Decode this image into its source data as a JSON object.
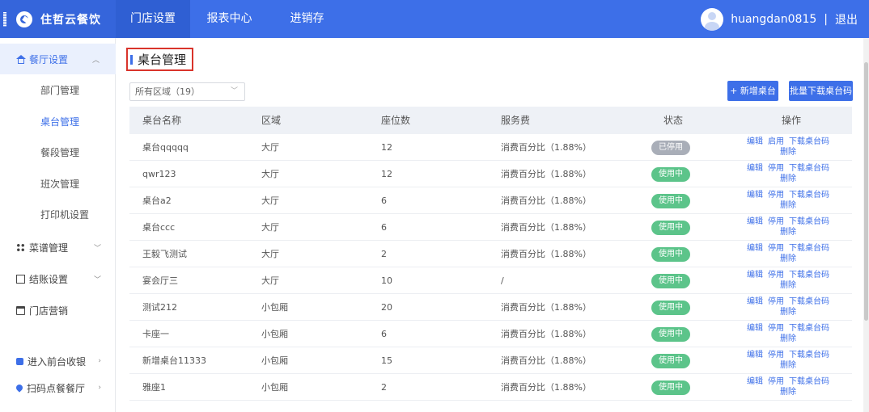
{
  "header": {
    "brand": "住哲云餐饮",
    "tabs": [
      "门店设置",
      "报表中心",
      "进销存"
    ],
    "username": "huangdan0815",
    "separator": "|",
    "logout": "退出"
  },
  "sidebar": {
    "group_restaurant": "餐厅设置",
    "items": [
      "部门管理",
      "桌台管理",
      "餐段管理",
      "班次管理",
      "打印机设置"
    ],
    "group_menu": "菜谱管理",
    "group_checkout": "结账设置",
    "group_marketing": "门店营销",
    "link_front": "进入前台收银",
    "link_scan": "扫码点餐餐厅"
  },
  "page": {
    "title": "桌台管理",
    "area_filter": "所有区域（19）",
    "btn_add": "+ 新增桌台",
    "btn_download": "批量下载桌台码"
  },
  "table": {
    "headers": [
      "桌台名称",
      "区域",
      "座位数",
      "服务费",
      "状态",
      "操作"
    ],
    "rows": [
      {
        "name": "桌台qqqqq",
        "area": "大厅",
        "seats": "12",
        "fee": "消费百分比（1.88%）",
        "status": "已停用",
        "toggle": "启用"
      },
      {
        "name": "qwr123",
        "area": "大厅",
        "seats": "12",
        "fee": "消费百分比（1.88%）",
        "status": "使用中",
        "toggle": "停用"
      },
      {
        "name": "桌台a2",
        "area": "大厅",
        "seats": "6",
        "fee": "消费百分比（1.88%）",
        "status": "使用中",
        "toggle": "停用"
      },
      {
        "name": "桌台ccc",
        "area": "大厅",
        "seats": "6",
        "fee": "消费百分比（1.88%）",
        "status": "使用中",
        "toggle": "停用"
      },
      {
        "name": "王毅飞测试",
        "area": "大厅",
        "seats": "2",
        "fee": "消费百分比（1.88%）",
        "status": "使用中",
        "toggle": "停用"
      },
      {
        "name": "宴会厅三",
        "area": "大厅",
        "seats": "10",
        "fee": "/",
        "status": "使用中",
        "toggle": "停用"
      },
      {
        "name": "测试212",
        "area": "小包厢",
        "seats": "20",
        "fee": "消费百分比（1.88%）",
        "status": "使用中",
        "toggle": "停用"
      },
      {
        "name": "卡座一",
        "area": "小包厢",
        "seats": "6",
        "fee": "消费百分比（1.88%）",
        "status": "使用中",
        "toggle": "停用"
      },
      {
        "name": "新增桌台11333",
        "area": "小包厢",
        "seats": "15",
        "fee": "消费百分比（1.88%）",
        "status": "使用中",
        "toggle": "停用"
      },
      {
        "name": "雅座1",
        "area": "小包厢",
        "seats": "2",
        "fee": "消费百分比（1.88%）",
        "status": "使用中",
        "toggle": "停用"
      }
    ],
    "op_edit": "编辑",
    "op_download": "下载桌台码",
    "op_delete": "删除"
  },
  "colors": {
    "accent": "#3d6fe8",
    "active_badge": "#5cc48a",
    "inactive_badge": "#a9aeb8",
    "highlight_border": "#d9342b"
  }
}
